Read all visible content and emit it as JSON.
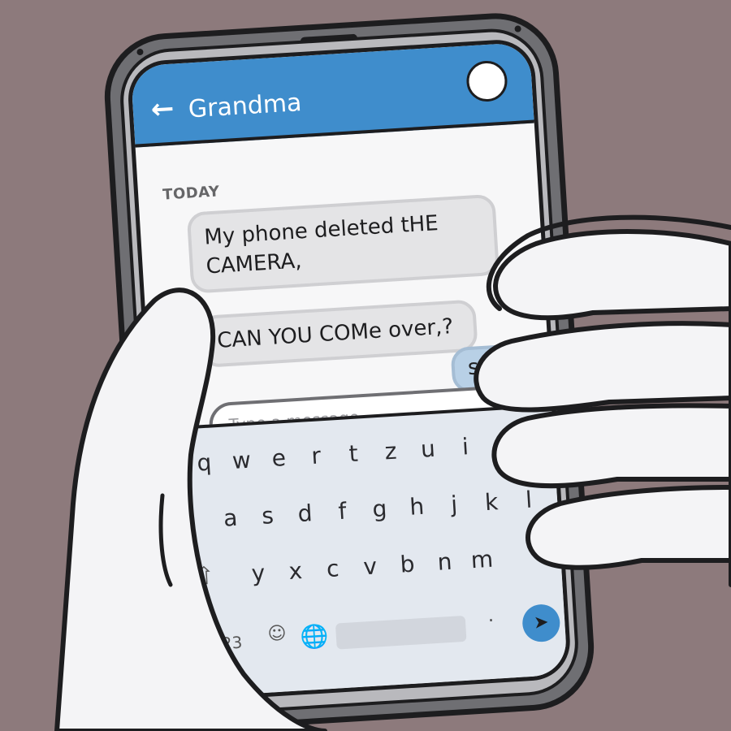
{
  "header": {
    "back_icon": "arrow-left-icon",
    "contact_name": "Grandma",
    "avatar_icon": "avatar-circle"
  },
  "conversation": {
    "day_label": "TODAY",
    "messages": [
      {
        "direction": "incoming",
        "text": "My phone deleted tHE CAMERA,"
      },
      {
        "direction": "incoming",
        "text": "CAN YOU COMe over,?"
      },
      {
        "direction": "outgoing",
        "text": "sure"
      }
    ]
  },
  "composer": {
    "placeholder": "Type a message...",
    "value": "",
    "mic_icon": "microphone-icon"
  },
  "keyboard": {
    "row1": [
      "q",
      "w",
      "e",
      "r",
      "t",
      "z",
      "u",
      "i"
    ],
    "row2": [
      "a",
      "s",
      "d",
      "f",
      "g",
      "h",
      "j",
      "k",
      "l"
    ],
    "row3": [
      "y",
      "x",
      "c",
      "v",
      "b",
      "n",
      "m"
    ],
    "shift_icon": "shift-arrow-icon",
    "num_label": "123",
    "emoji_icon": "smiley-icon",
    "globe_icon": "globe-icon",
    "period": ".",
    "send_icon": "send-arrow-icon"
  },
  "colors": {
    "header": "#3f8dcc",
    "incoming_bubble": "#e4e4e6",
    "outgoing_bubble": "#b8d0e6",
    "background": "#8d7a7c",
    "send_button": "#3f8dcc"
  }
}
